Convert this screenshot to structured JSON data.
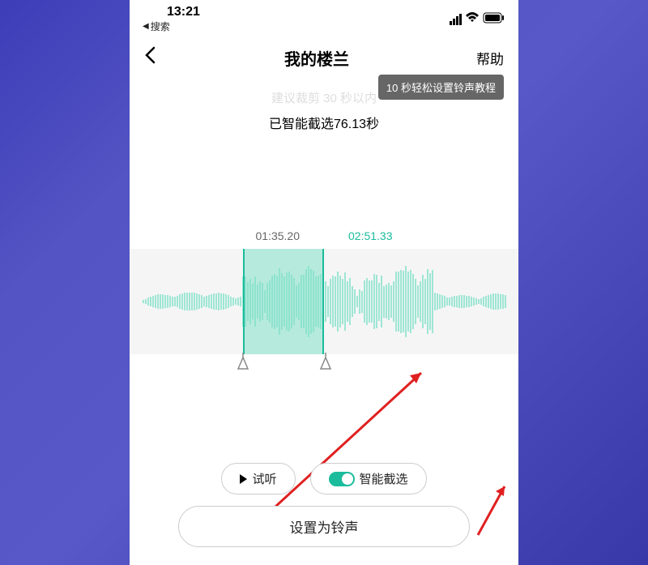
{
  "status": {
    "time": "13:21",
    "back_search": "搜索"
  },
  "nav": {
    "title": "我的楼兰",
    "help": "帮助"
  },
  "tooltip": "10 秒轻松设置铃声教程",
  "hint": "建议裁剪 30 秒以内",
  "duration": "已智能截选76.13秒",
  "times": {
    "start": "01:35.20",
    "end": "02:51.33"
  },
  "controls": {
    "preview": "试听",
    "smart_select": "智能截选",
    "set_ringtone": "设置为铃声"
  }
}
